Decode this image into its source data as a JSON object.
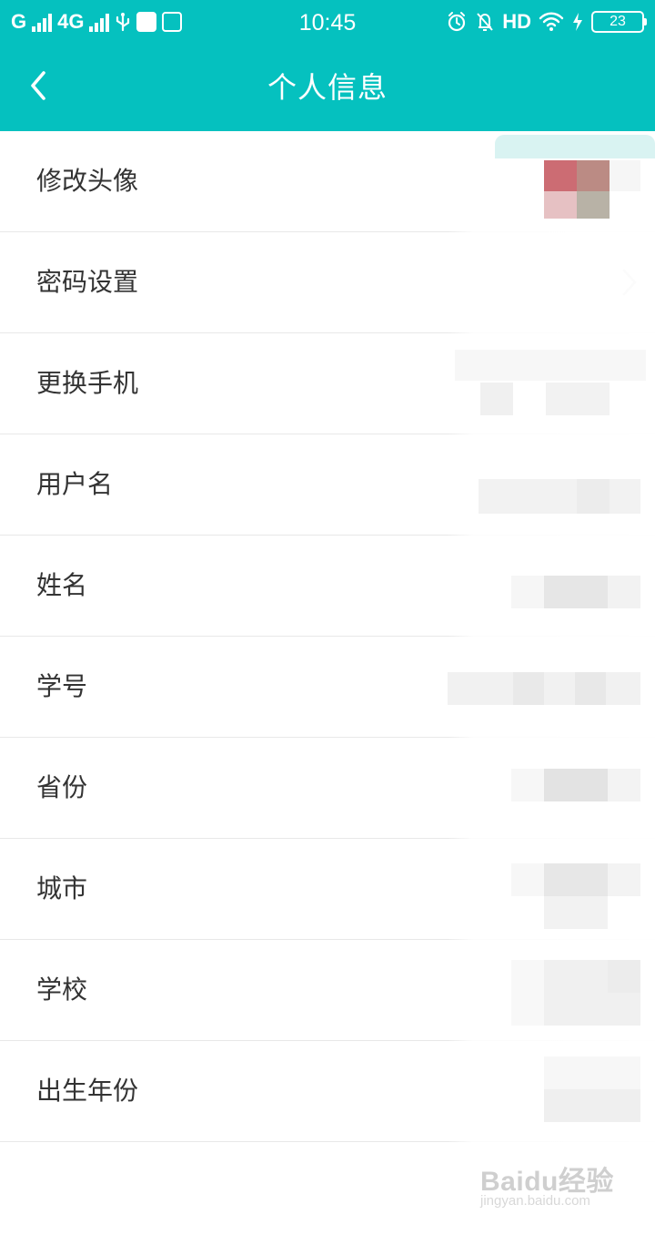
{
  "status_bar": {
    "carrier1": "G",
    "carrier2": "4G",
    "time": "10:45",
    "hd": "HD",
    "battery": "23",
    "icons": [
      "signal-bars-icon",
      "usb-icon",
      "app-badge-icon",
      "screenshot-icon",
      "alarm-icon",
      "silent-icon",
      "wifi-icon",
      "charging-icon",
      "battery-icon"
    ]
  },
  "header": {
    "title": "个人信息",
    "back_icon": "chevron-left-icon",
    "background": "#05c1bf"
  },
  "list": {
    "items": [
      {
        "label": "修改头像"
      },
      {
        "label": "密码设置",
        "chevron": "chevron-right-icon"
      },
      {
        "label": "更换手机"
      },
      {
        "label": "用户名"
      },
      {
        "label": "姓名"
      },
      {
        "label": "学号"
      },
      {
        "label": "省份"
      },
      {
        "label": "城市"
      },
      {
        "label": "学校"
      },
      {
        "label": "出生年份"
      }
    ]
  },
  "watermark": {
    "logo_left": "Bai",
    "logo_right": "du",
    "logo_suffix": "经验",
    "url": "jingyan.baidu.com"
  }
}
